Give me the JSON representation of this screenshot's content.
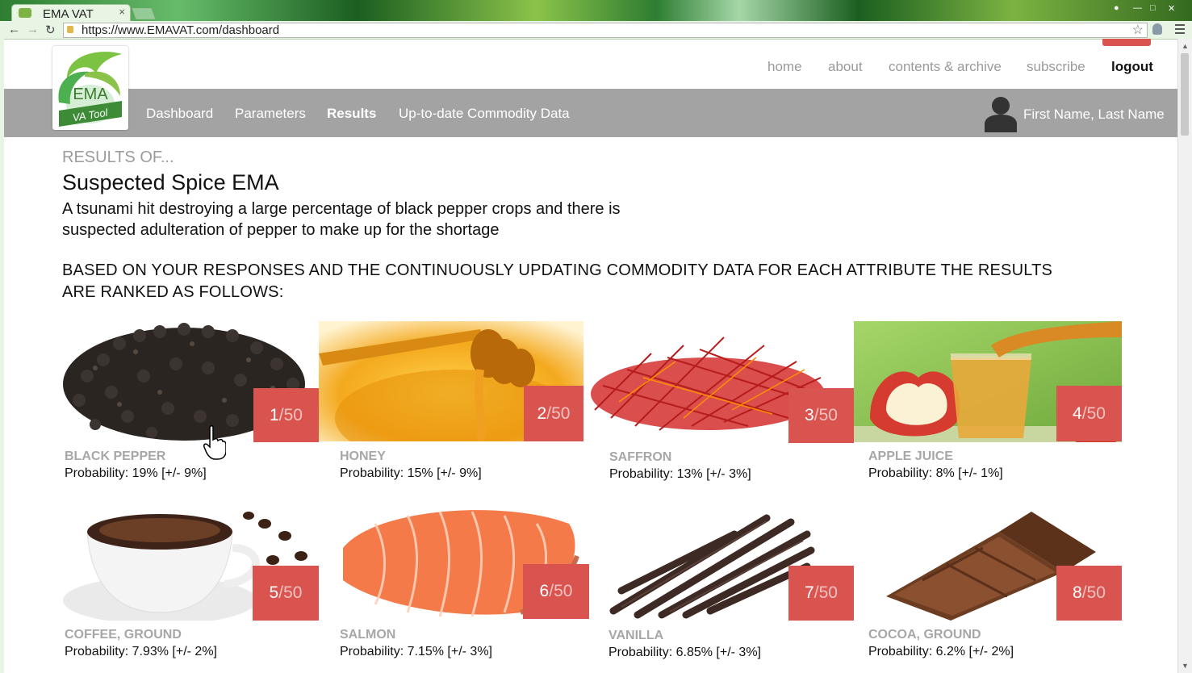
{
  "browser": {
    "tab_title": "EMA VAT",
    "tab_close": "×",
    "url": "https://www.EMAVAT.com/dashboard"
  },
  "site": {
    "logo": {
      "text_main": "EMA",
      "text_banner": "VA Tool"
    },
    "top_nav": [
      "home",
      "about",
      "contents & archive",
      "subscribe",
      "logout"
    ],
    "main_nav": [
      "Dashboard",
      "Parameters",
      "Results",
      "Up-to-date Commodity Data"
    ],
    "active_main_nav": "Results",
    "user_name": "First Name, Last Name"
  },
  "content": {
    "results_label": "RESULTS OF...",
    "scenario_title": "Suspected Spice EMA",
    "scenario_description": "A tsunami hit destroying a large percentage of black pepper crops and there is suspected adulteration of pepper to make up for the shortage",
    "ranking_intro": "BASED ON YOUR RESPONSES AND THE CONTINUOUSLY UPDATING COMMODITY DATA FOR EACH ATTRIBUTE THE RESULTS ARE RANKED AS FOLLOWS:"
  },
  "results": [
    {
      "rank": "1",
      "of": "/50",
      "name": "BLACK PEPPER",
      "probability": "Probability: 19% [+/- 9%]",
      "image": "black-pepper-image"
    },
    {
      "rank": "2",
      "of": "/50",
      "name": "HONEY",
      "probability": "Probability: 15% [+/- 9%]",
      "image": "honey-image"
    },
    {
      "rank": "3",
      "of": "/50",
      "name": "SAFFRON",
      "probability": "Probability: 13% [+/- 3%]",
      "image": "saffron-image"
    },
    {
      "rank": "4",
      "of": "/50",
      "name": "APPLE JUICE",
      "probability": "Probability: 8% [+/- 1%]",
      "image": "apple-juice-image"
    },
    {
      "rank": "5",
      "of": "/50",
      "name": "COFFEE, GROUND",
      "probability": "Probability: 7.93% [+/- 2%]",
      "image": "coffee-image"
    },
    {
      "rank": "6",
      "of": "/50",
      "name": "SALMON",
      "probability": "Probability: 7.15% [+/- 3%]",
      "image": "salmon-image"
    },
    {
      "rank": "7",
      "of": "/50",
      "name": "VANILLA",
      "probability": "Probability: 6.85% [+/- 3%]",
      "image": "vanilla-image"
    },
    {
      "rank": "8",
      "of": "/50",
      "name": "COCOA, GROUND",
      "probability": "Probability: 6.2% [+/- 2%]",
      "image": "cocoa-image"
    }
  ],
  "colors": {
    "accent_red": "#d9534f",
    "nav_bar_gray": "#a3a3a3",
    "label_gray": "#a7a7a7",
    "brand_green": "#4caf50"
  }
}
